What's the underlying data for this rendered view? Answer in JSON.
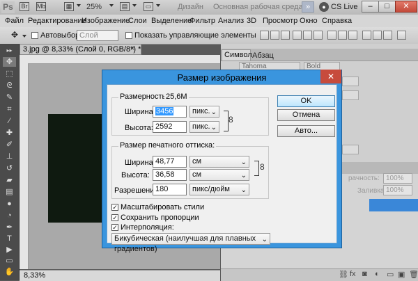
{
  "app": {
    "logo": "Ps",
    "zoom": "25%",
    "workspace_label": "Дизайн",
    "workspace_active": "Основная рабочая среда",
    "more_label": "»",
    "cslive": "CS Live",
    "win_min": "–",
    "win_max": "□",
    "win_close": "✕"
  },
  "menu": [
    "Файл",
    "Редактирование",
    "Изображение",
    "Слои",
    "Выделение",
    "Фильтр",
    "Анализ",
    "3D",
    "Просмотр",
    "Окно",
    "Справка"
  ],
  "options": {
    "autoselect_label": "Автовыбор:",
    "autoselect_value": "Слой",
    "show_controls_label": "Показать управляющие элементы"
  },
  "document": {
    "tab_title": "3.jpg @ 8,33% (Слой 0, RGB/8*) *",
    "close": "×",
    "zoom_status": "8,33%"
  },
  "panels": {
    "tab_symbol": "Символ",
    "tab_paragraph": "Абзац",
    "font": "Tahoma",
    "style": "Bold",
    "opacity_label": "рачность:",
    "opacity_value": "100%",
    "fill_label": "Заливка:",
    "fill_value": "100%"
  },
  "dialog": {
    "title": "Размер изображения",
    "close": "✕",
    "pixel_dims_label": "Размерность:",
    "pixel_dims_value": "25,6M",
    "width_label": "Ширина:",
    "width_value": "3456",
    "width_unit": "пикс.",
    "height_label": "Высота:",
    "height_value": "2592",
    "height_unit": "пикс.",
    "print_size_label": "Размер печатного оттиска:",
    "doc_width_label": "Ширина:",
    "doc_width_value": "48,77",
    "doc_width_unit": "см",
    "doc_height_label": "Высота:",
    "doc_height_value": "36,58",
    "doc_height_unit": "см",
    "resolution_label": "Разрешение:",
    "resolution_value": "180",
    "resolution_unit": "пикс/дюйм",
    "scale_styles_label": "Масштабировать стили",
    "constrain_label": "Сохранить пропорции",
    "resample_label": "Интерполяция:",
    "resample_value": "Бикубическая (наилучшая для плавных градиентов)",
    "ok_label": "OK",
    "cancel_label": "Отмена",
    "auto_label": "Авто..."
  }
}
